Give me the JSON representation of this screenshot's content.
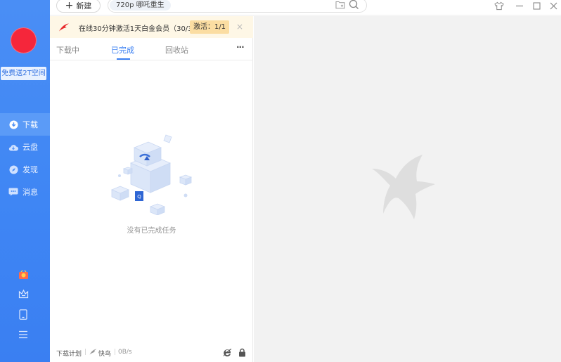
{
  "sidebar": {
    "free_space_label": "免费送2T空间",
    "items": [
      {
        "label": "下载",
        "icon": "download-icon",
        "active": true
      },
      {
        "label": "云盘",
        "icon": "cloud-icon",
        "active": false
      },
      {
        "label": "发现",
        "icon": "compass-icon",
        "active": false
      },
      {
        "label": "消息",
        "icon": "message-icon",
        "active": false
      }
    ],
    "bottom_icons": [
      "gift-icon",
      "crown-icon",
      "tablet-icon",
      "menu-icon"
    ]
  },
  "toolbar": {
    "new_label": "新建",
    "search_tag": "720p  哪吒重生"
  },
  "promo": {
    "text": "在线30分钟激活1天白金会员（30/30...",
    "button": "激活：1/1",
    "close": "×"
  },
  "tabs": [
    {
      "label": "下载中",
      "active": false
    },
    {
      "label": "已完成",
      "active": true
    },
    {
      "label": "回收站",
      "active": false
    }
  ],
  "more_label": "···",
  "empty_text": "没有已完成任务",
  "footer": {
    "plan_label": "下载计划",
    "bird_label": "快鸟",
    "speed": "0B/s"
  },
  "colors": {
    "accent": "#3a7ff2",
    "sidebar": "#4a8ef5",
    "avatar": "#f5263b",
    "promo_bg": "#fef7e6"
  }
}
